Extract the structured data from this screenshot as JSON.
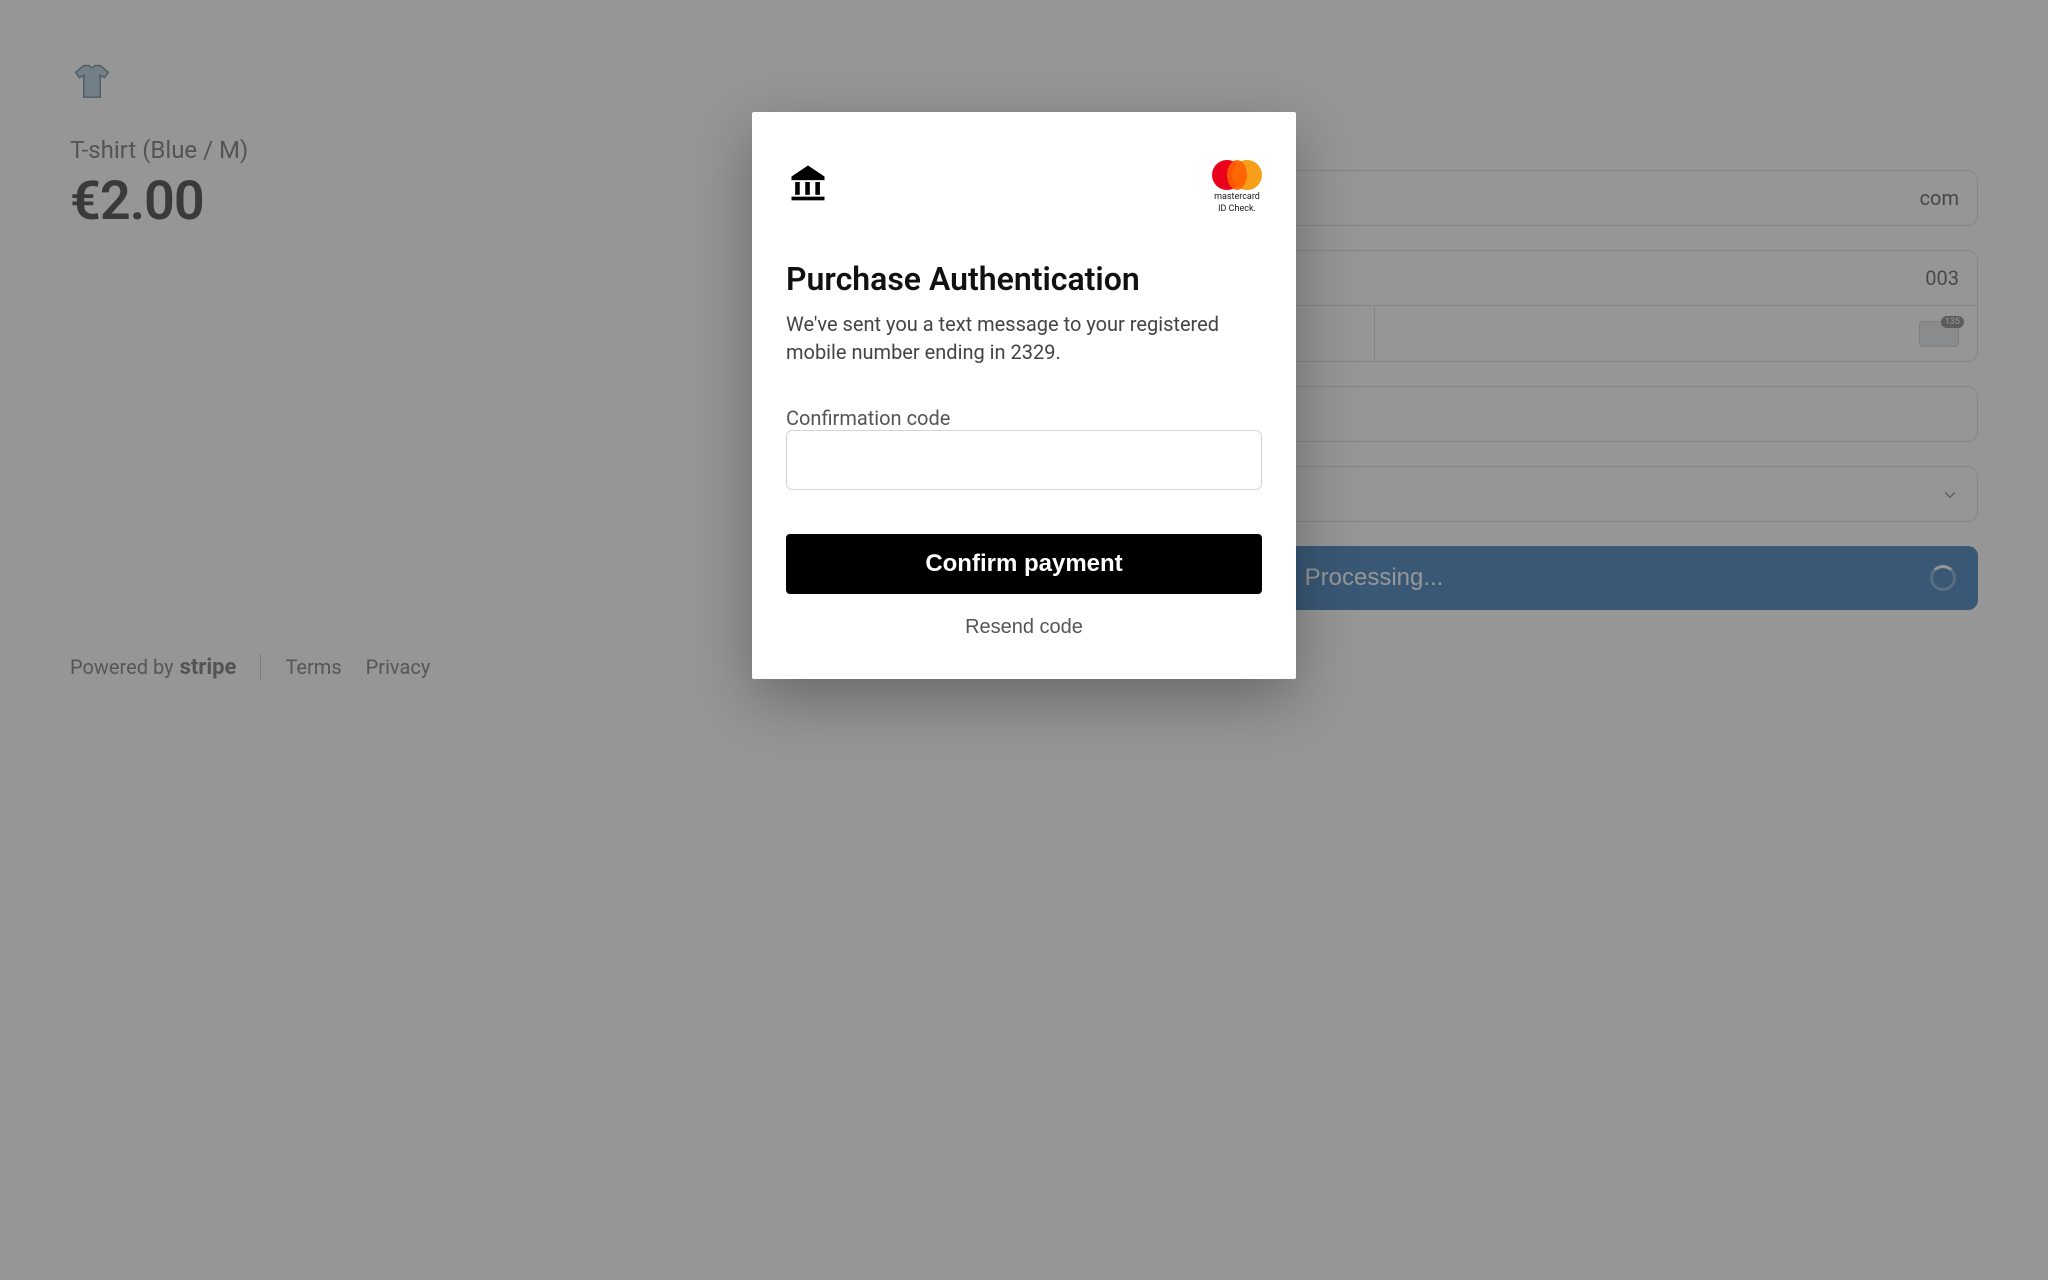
{
  "product": {
    "name": "T-shirt (Blue / M)",
    "price": "€2.00"
  },
  "footer": {
    "powered_by": "Powered by",
    "brand": "stripe",
    "terms": "Terms",
    "privacy": "Privacy"
  },
  "checkout": {
    "email_suffix": "com",
    "card_suffix": "003",
    "processing_label": "Processing..."
  },
  "modal": {
    "title": "Purchase Authentication",
    "body": "We've sent you a text message to your registered mobile number ending in 2329.",
    "code_label": "Confirmation code",
    "confirm_label": "Confirm payment",
    "resend_label": "Resend code",
    "mc_line1": "mastercard",
    "mc_line2": "ID Check."
  }
}
